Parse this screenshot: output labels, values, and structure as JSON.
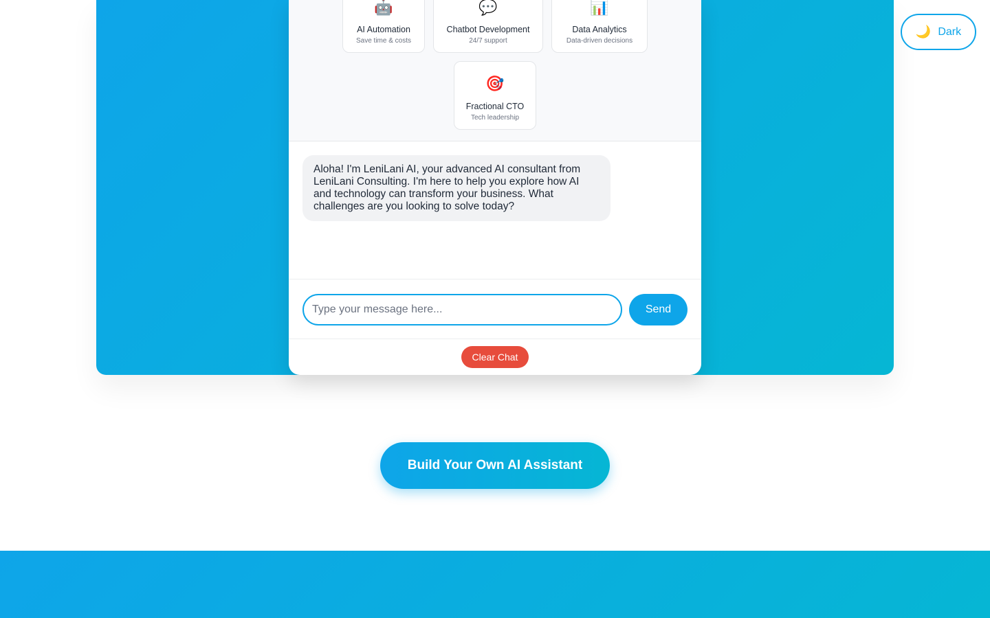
{
  "services": [
    {
      "icon": "robot-icon",
      "glyph": "🤖",
      "title": "AI Automation",
      "subtitle": "Save time & costs"
    },
    {
      "icon": "speech-bubble-icon",
      "glyph": "💬",
      "title": "Chatbot Development",
      "subtitle": "24/7 support"
    },
    {
      "icon": "bar-chart-icon",
      "glyph": "📊",
      "title": "Data Analytics",
      "subtitle": "Data-driven decisions"
    },
    {
      "icon": "target-icon",
      "glyph": "🎯",
      "title": "Fractional CTO",
      "subtitle": "Tech leadership"
    }
  ],
  "chat": {
    "assistant_message": "Aloha! I'm LeniLani AI, your advanced AI consultant from LeniLani Consulting. I'm here to help you explore how AI and technology can transform your business. What challenges are you looking to solve today?",
    "input_placeholder": "Type your message here...",
    "input_value": "",
    "send_label": "Send",
    "clear_label": "Clear Chat"
  },
  "theme_toggle": {
    "icon": "moon-icon",
    "glyph": "🌙",
    "label": "Dark"
  },
  "cta": {
    "label": "Build Your Own AI Assistant"
  },
  "colors": {
    "accent": "#0ea5e9",
    "danger": "#e74c3c"
  }
}
